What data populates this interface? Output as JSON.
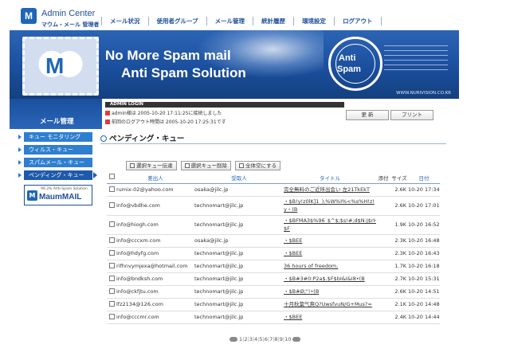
{
  "header": {
    "logo_mark": "M",
    "app_title": "Admin Center",
    "app_sub": "マウム・メール 管理者",
    "nav": [
      "メール状況",
      "使用者グループ",
      "メール管理",
      "統計履歴",
      "環境設定",
      "ログアウト"
    ]
  },
  "banner": {
    "line1": "No More Spam mail",
    "line2": "Anti Spam Solution",
    "stamp_line1": "Anti",
    "stamp_line2": "Spam",
    "envelope_mark": "M",
    "url": "WWW.NURIVISION.CO.KR"
  },
  "sidebar": {
    "title": "メール管理",
    "items": [
      "キュー モニタリング",
      "ウィルス・キュー",
      "スパムメール・キュー",
      "ペンディング・キュー"
    ],
    "active_index": 3,
    "maum_pct": "99.3% Anti-Spam Solution",
    "maum_brand": "MaumMAIL",
    "maum_icon": "M"
  },
  "login": {
    "header": "ADMIN LOGIN",
    "line1": "admin様は 2005-10-20 17:11:25に接続しました",
    "line2": "前回のログアウト時間は 2005-10-20 17:25:31です"
  },
  "toolbar": {
    "refresh": "更 新",
    "print": "プリント"
  },
  "section": {
    "title": "ペンディング・キュー"
  },
  "actions": [
    "選択キュー伝達",
    "選択キュー削除",
    "全体空にする"
  ],
  "table": {
    "headers": {
      "sender": "差出人",
      "recipient": "受取人",
      "title": "タイトル",
      "attach": "添付",
      "size": "サイズ",
      "date": "日付"
    },
    "rows": [
      {
        "sender": "rumix-02@yahoo.com",
        "recipient": "osaka@jilc.jp",
        "title": [
          "完全無料のご近所出会い 左21TkEkT"
        ],
        "size": "2.6K",
        "date": "10-20 17:34"
      },
      {
        "sender": "info@vbdhe.com",
        "recipient": "technomart@jilc.jp",
        "title": [
          "・$B!y!z0lK]1_),%W%I%<%s%H!z!",
          "y・(B"
        ],
        "size": "2.6K",
        "date": "10-20 17:01"
      },
      {
        "sender": "info@hiogh.com",
        "recipient": "technomart@jilc.jp",
        "title": [
          "・$BFMA3$%96_$^$;$s!#;d$N:J$rHH$7",
          "$F"
        ],
        "size": "1.9K",
        "date": "10-20 16:52"
      },
      {
        "sender": "info@cccxm.com",
        "recipient": "osaka@jilc.jp",
        "title": [
          "・$BEE"
        ],
        "size": "2.3K",
        "date": "10-20 16:48"
      },
      {
        "sender": "info@hdyfg.com",
        "recipient": "technomart@jilc.jp",
        "title": [
          "・$BEE"
        ],
        "size": "2.3K",
        "date": "10-20 16:43"
      },
      {
        "sender": "rifhnvymjexa@hotmail.com",
        "recipient": "technomart@jilc.jp",
        "title": [
          "36 hours of freedom."
        ],
        "size": "1.7K",
        "date": "10-20 16:18"
      },
      {
        "sender": "info@bndksh.com",
        "recipient": "technomart@jilc.jp",
        "title": [
          "・$B#3#0:P2a$.$F$bI&I&I8•(B"
        ],
        "size": "2.7K",
        "date": "10-20 15:31"
      },
      {
        "sender": "info@ckfjtu.com",
        "recipient": "technomart@jilc.jp",
        "title": [
          "・$B#Ø;\"!•(B"
        ],
        "size": "2.6K",
        "date": "10-20 14:51"
      },
      {
        "sender": "lfz2134@126.com",
        "recipient": "technomart@jilc.jp",
        "title": [
          "十月秋葉气爽Q?UwsfvuN/G+Mus?="
        ],
        "size": "2.1K",
        "date": "10-20 14:48"
      },
      {
        "sender": "info@cccmr.com",
        "recipient": "technomart@jilc.jp",
        "title": [
          "・$BEE"
        ],
        "size": "2.4K",
        "date": "10-20 14:44"
      }
    ]
  },
  "pager": {
    "pages": [
      "1",
      "2",
      "3",
      "4",
      "5",
      "6",
      "7",
      "8",
      "9",
      "10"
    ]
  },
  "colors": {
    "primary_blue": "#1f66b8",
    "banner_blue": "#1b4f9e",
    "sidebar_item": "#2f7fd0"
  }
}
